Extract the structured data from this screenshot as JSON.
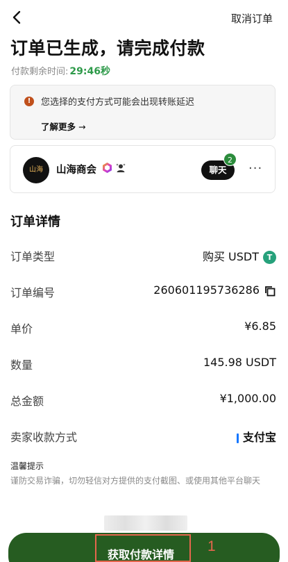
{
  "header": {
    "cancel_label": "取消订单"
  },
  "title": "订单已生成，请完成付款",
  "timer": {
    "label": "付款剩余时间:",
    "value": "29:46秒"
  },
  "notice": {
    "text": "您选择的支付方式可能会出现转账延迟",
    "learn_more": "了解更多",
    "arrow": "→"
  },
  "merchant": {
    "name": "山海商会",
    "avatar_text": "山海",
    "chat_label": "聊天",
    "chat_unread": "2",
    "more": "···"
  },
  "details": {
    "section_title": "订单详情",
    "rows": [
      {
        "label": "订单类型",
        "value": "购买 USDT"
      },
      {
        "label": "订单编号",
        "value": "260601195736286"
      },
      {
        "label": "单价",
        "value": "¥6.85"
      },
      {
        "label": "数量",
        "value": "145.98 USDT"
      },
      {
        "label": "总金额",
        "value": "¥1,000.00"
      },
      {
        "label": "卖家收款方式",
        "value": "支付宝"
      }
    ]
  },
  "tips": {
    "title": "温馨提示",
    "body": "谨防交易诈骗，切勿轻信对方提供的支付截图、或使用其他平台聊天"
  },
  "cta": {
    "label": "获取付款详情",
    "step": "1"
  },
  "colors": {
    "accent_green": "#2e9a4a",
    "button_green": "#265c21",
    "highlight": "#e5664d",
    "tether": "#26a17b",
    "alipay": "#1677ff"
  }
}
